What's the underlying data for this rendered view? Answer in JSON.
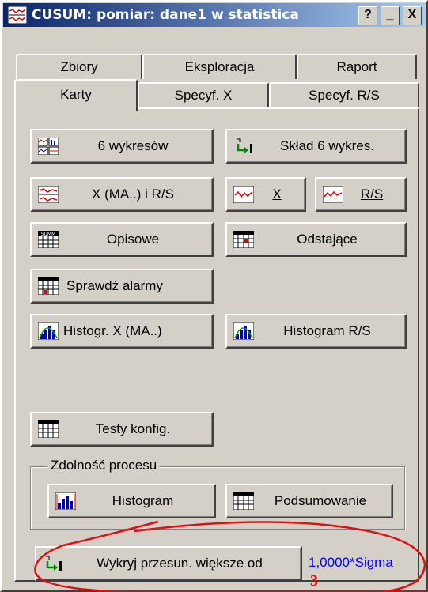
{
  "window": {
    "title": "CUSUM: pomiar: dane1 w statistica",
    "help_label": "?",
    "minimize_label": "_",
    "close_label": "X"
  },
  "tabs_row1": [
    "Zbiory",
    "Eksploracja",
    "Raport"
  ],
  "tabs_row2": [
    "Karty",
    "Specyf. X",
    "Specyf. R/S"
  ],
  "buttons": {
    "six_charts": "6 wykresów",
    "compose_six": "Skład 6 wykres.",
    "x_ma_rs": "X (MA..) i R/S",
    "x": "X",
    "rs": "R/S",
    "descriptive": "Opisowe",
    "outliers": "Odstające",
    "check_alarms": "Sprawdź alarmy",
    "histogram_x": "Histogr. X (MA..)",
    "histogram_rs": "Histogram R/S",
    "test_config": "Testy konfig.",
    "histogram": "Histogram",
    "summary": "Podsumowanie",
    "detect_shift": "Wykryj przesun. większe od"
  },
  "capability_group": {
    "title": "Zdolność procesu"
  },
  "shift_value": "1,0000*Sigma",
  "annotation": {
    "label": "3"
  },
  "colors": {
    "face": "#d4d0c8",
    "title_start": "#0a246a",
    "title_end": "#a6caf0",
    "annotation_red": "#e01010",
    "link_blue": "#0000ff"
  }
}
